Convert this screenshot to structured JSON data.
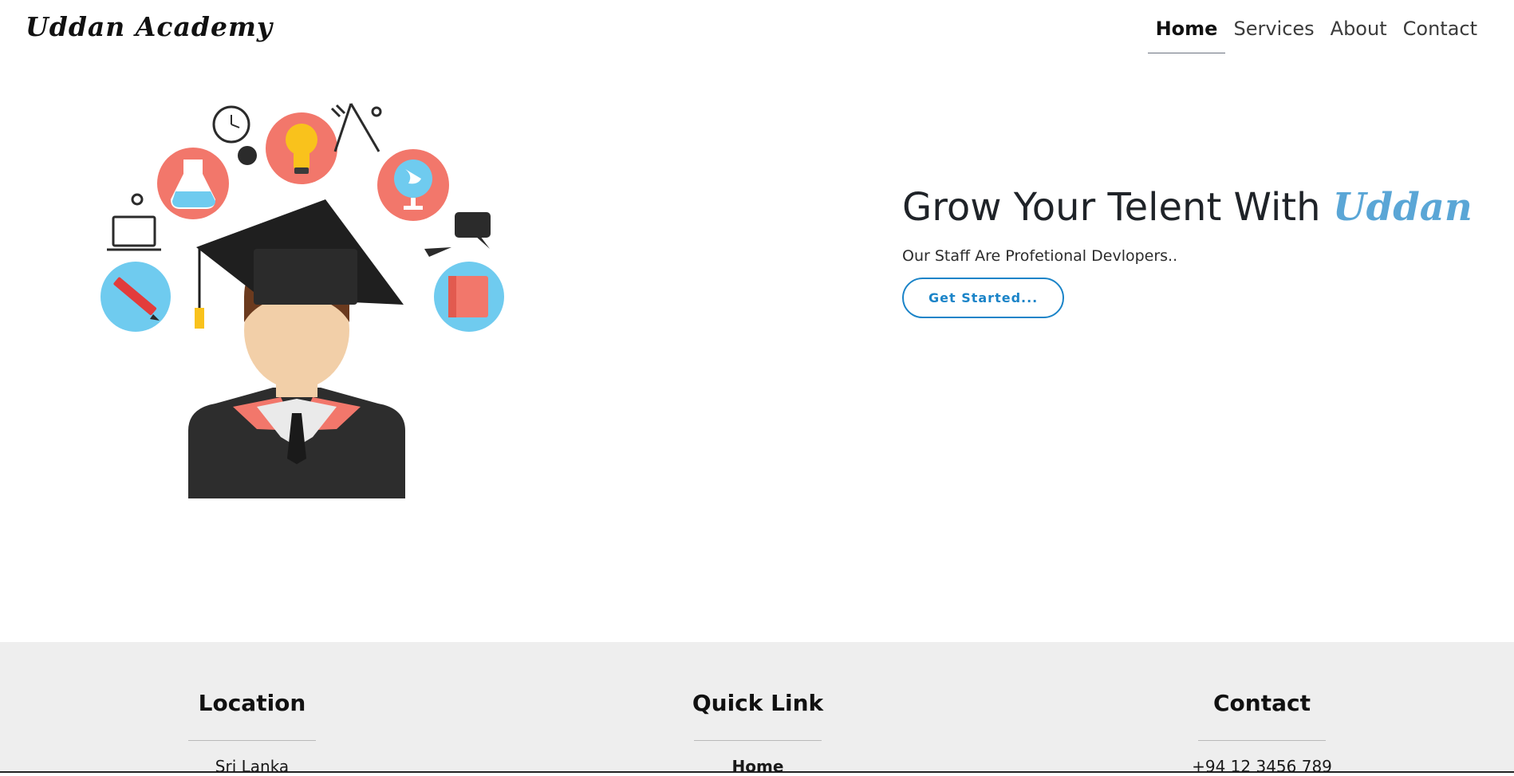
{
  "brand": "Uddan Academy",
  "nav": {
    "items": [
      {
        "label": "Home",
        "active": true
      },
      {
        "label": "Services",
        "active": false
      },
      {
        "label": "About",
        "active": false
      },
      {
        "label": "Contact",
        "active": false
      }
    ]
  },
  "hero": {
    "title_prefix": "Grow Your Telent With",
    "title_accent": "Uddan",
    "subtitle": "Our Staff Are Profetional Devlopers..",
    "cta_label": "Get Started..."
  },
  "footer": {
    "columns": [
      {
        "heading": "Location",
        "item": "Sri Lanka"
      },
      {
        "heading": "Quick Link",
        "item": "Home"
      },
      {
        "heading": "Contact",
        "item": "+94 12 3456 789"
      }
    ]
  },
  "colors": {
    "accent": "#5aa6d6",
    "button": "#1b84c8",
    "footer_bg": "#eeeeee",
    "coral": "#f2776b",
    "sky": "#6fcbef"
  }
}
